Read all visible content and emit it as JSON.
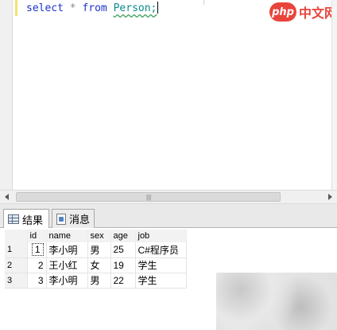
{
  "editor": {
    "keyword_select": "select",
    "operator_star": "*",
    "keyword_from": "from",
    "table_name": "Person;"
  },
  "watermark": {
    "badge": "php",
    "text": "中文网"
  },
  "scrollbar": {
    "grip": "|||"
  },
  "tabs": {
    "results_label": "结果",
    "messages_label": "消息"
  },
  "results": {
    "columns": [
      "id",
      "name",
      "sex",
      "age",
      "job"
    ],
    "rows": [
      {
        "row_number": "1",
        "id": "1",
        "name": "李小明",
        "sex": "男",
        "age": "25",
        "job": "C#程序员"
      },
      {
        "row_number": "2",
        "id": "2",
        "name": "王小红",
        "sex": "女",
        "age": "19",
        "job": "学生"
      },
      {
        "row_number": "3",
        "id": "3",
        "name": "李小明",
        "sex": "男",
        "age": "22",
        "job": "学生"
      }
    ]
  }
}
